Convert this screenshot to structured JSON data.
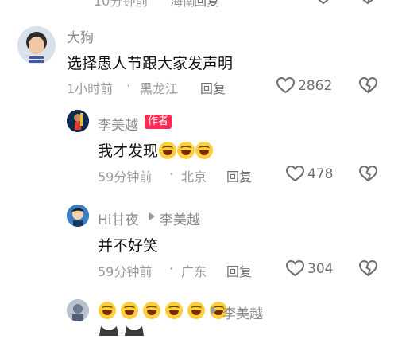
{
  "top_partial": {
    "time": "10分钟前",
    "location": "海南",
    "reply": "回复"
  },
  "comments": [
    {
      "username": "大狗",
      "text": "选择愚人节跟大家发声明",
      "time": "1小时前",
      "location": "黑龙江",
      "reply": "回复",
      "likes": "2862"
    },
    {
      "username": "李美越",
      "badge": "作者",
      "text": "我才发现",
      "emoji_icons": [
        "laugh-cry-icon",
        "laugh-cry-icon",
        "laugh-cry-icon"
      ],
      "time": "59分钟前",
      "location": "北京",
      "reply": "回复",
      "likes": "478"
    },
    {
      "username": "Hi甘夜",
      "reply_to": "李美越",
      "text": "并不好笑",
      "time": "59分钟前",
      "location": "广东",
      "reply": "回复",
      "likes": "304"
    },
    {
      "emoji_name_icons": [
        "grin-icon",
        "grin-icon",
        "grin-icon",
        "grin-icon",
        "grin-icon",
        "grin-icon"
      ],
      "reply_to": "李美越",
      "partial_icons": [
        "cat-icon",
        "cat-icon"
      ]
    }
  ],
  "separator": "·",
  "colors": {
    "badge": "#fe2c55",
    "meta": "#9a9a9a",
    "text": "#111111"
  }
}
